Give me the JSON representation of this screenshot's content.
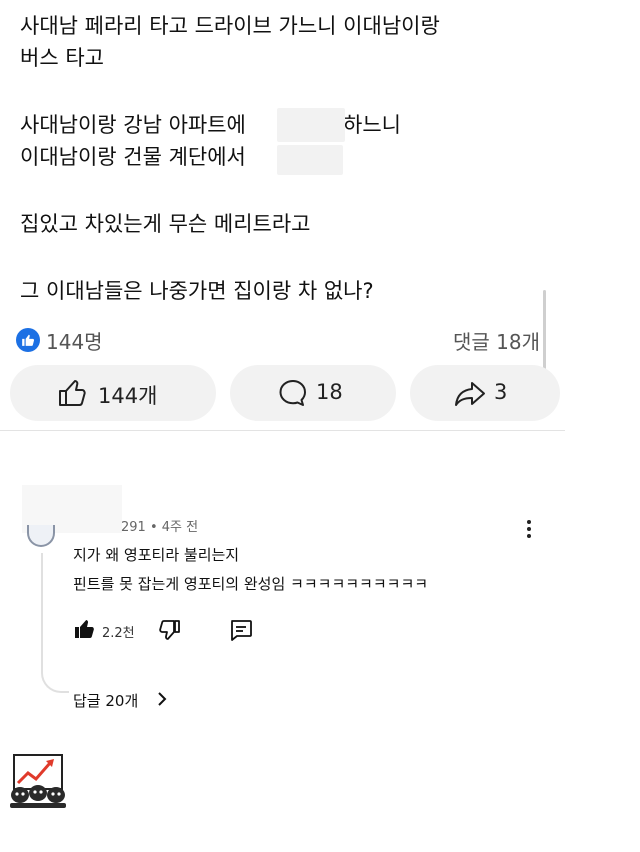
{
  "post": {
    "lines": [
      "사대남 페라리 타고 드라이브 가느니 이대남이랑",
      "버스 타고",
      "사대남이랑 강남 아파트에",
      "하느니",
      "이대남이랑 건물 계단에서",
      "집있고 차있는게 무슨 메리트라고",
      "그 이대남들은 나중가면 집이랑 차 없나?"
    ]
  },
  "stats": {
    "likes": "144명",
    "comments": "댓글 18개"
  },
  "actions": {
    "like_label": "144개",
    "comment_label": "18",
    "share_label": "3"
  },
  "comment": {
    "meta": "291 • 4주 전",
    "line1": "지가 왜 영포티라 불리는지",
    "line2": "핀트를 못 잡는게 영포티의 완성임 ㅋㅋㅋㅋㅋㅋㅋㅋㅋㅋ",
    "like_count": "2.2천",
    "replies_label": "답글 20개"
  },
  "colors": {
    "accent": "#1c70e4",
    "pill_bg": "#f2f2f2",
    "logo_arrow": "#e03a2b"
  }
}
